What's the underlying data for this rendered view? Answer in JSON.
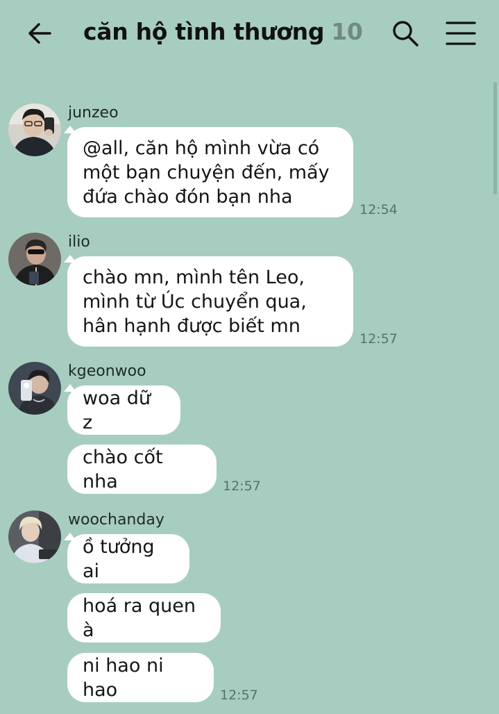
{
  "header": {
    "title": "căn hộ tình thương",
    "member_count": "10",
    "back_icon": "arrow-left-icon",
    "search_icon": "search-icon",
    "menu_icon": "hamburger-menu-icon"
  },
  "messages": [
    {
      "sender": "junzeo",
      "bubbles": [
        "@all, căn hộ mình vừa có một bạn chuyện đến, mấy đứa chào đón bạn nha"
      ],
      "time": "12:54"
    },
    {
      "sender": "ilio",
      "bubbles": [
        "chào mn, mình tên Leo, mình từ Úc chuyển qua, hân hạnh được biết mn"
      ],
      "time": "12:57"
    },
    {
      "sender": "kgeonwoo",
      "bubbles": [
        "woa dữ z",
        "chào cốt nha"
      ],
      "time": "12:57"
    },
    {
      "sender": "woochanday",
      "bubbles": [
        "ồ tưởng ai",
        "hoá ra quen à",
        "ni hao ni hao"
      ],
      "time": "12:57"
    }
  ],
  "colors": {
    "background": "#a6cdc0",
    "bubble": "#ffffff",
    "time": "#57716b",
    "count": "#6f8a84"
  }
}
